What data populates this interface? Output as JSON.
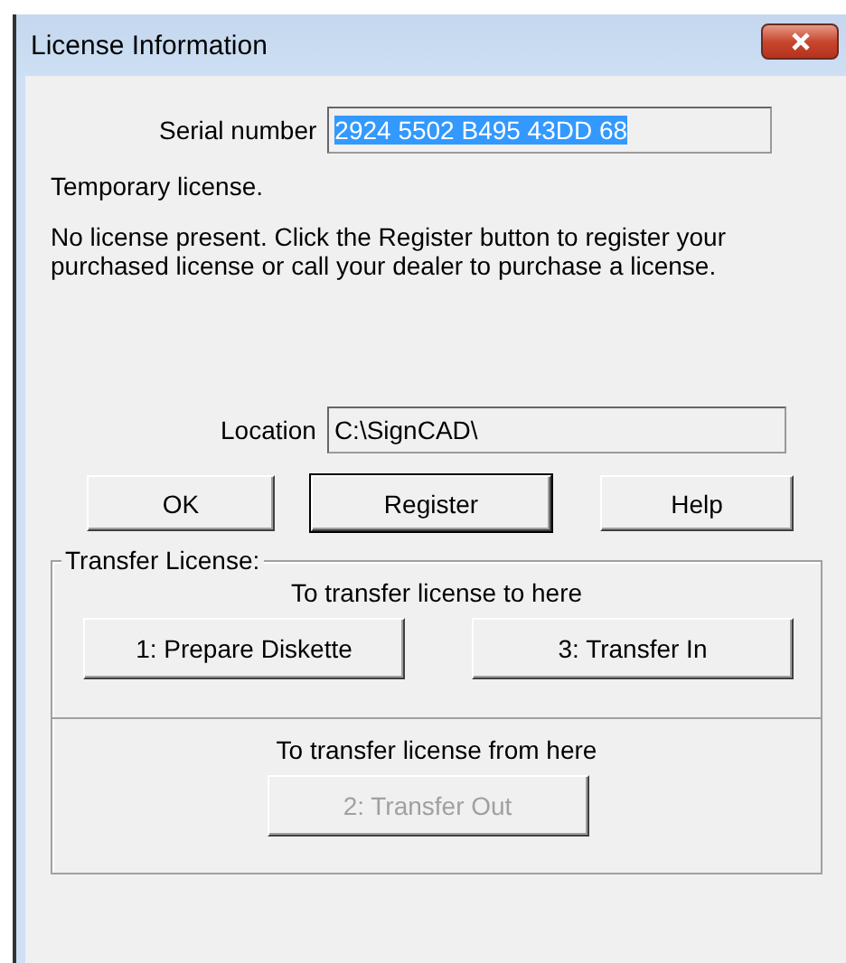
{
  "window": {
    "title": "License Information"
  },
  "serial": {
    "label": "Serial number",
    "value": "2924 5502 B495 43DD 68",
    "selected": true
  },
  "status": "Temporary license.",
  "message": "No license present.  Click the Register button to register your purchased license or call your dealer to purchase a license.",
  "location": {
    "label": "Location",
    "value": "C:\\SignCAD\\"
  },
  "buttons": [
    {
      "label": "OK",
      "default": false
    },
    {
      "label": "Register",
      "default": true
    },
    {
      "label": "Help",
      "default": false
    }
  ],
  "transfer": {
    "title": "Transfer License:",
    "to_here": {
      "caption": "To transfer license to here",
      "buttons": [
        {
          "label": "1: Prepare Diskette",
          "disabled": false
        },
        {
          "label": "3: Transfer In",
          "disabled": false
        }
      ]
    },
    "from_here": {
      "caption": "To transfer license from here",
      "buttons": [
        {
          "label": "2: Transfer Out",
          "disabled": true
        }
      ]
    }
  }
}
